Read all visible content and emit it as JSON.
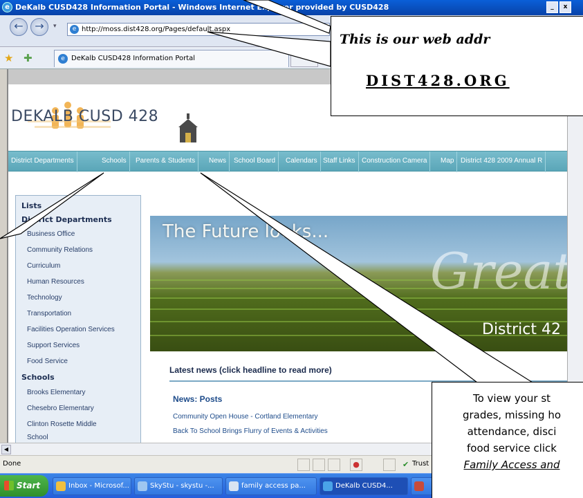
{
  "window": {
    "title": "DeKalb CUSD428 Information Portal - Windows Internet Explorer provided by CUSD428"
  },
  "browser": {
    "address": "http://moss.dist428.org/Pages/default.aspx",
    "tab_title": "DeKalb CUSD428 Information Portal"
  },
  "site": {
    "logo_text": "DEKALB CUSD 428",
    "nav": [
      "District Departments",
      "Schools",
      "Parents & Students",
      "News",
      "School Board",
      "Calendars",
      "Staff Links",
      "Construction Camera",
      "Map",
      "District 428 2009 Annual R"
    ],
    "sidebar": {
      "title": "Lists",
      "section1": "District Departments",
      "depts": [
        "Business Office",
        "Community Relations",
        "Curriculum",
        "Human Resources",
        "Technology",
        "Transportation",
        "Facilities Operation Services",
        "Support Services",
        "Food Service"
      ],
      "section2": "Schools",
      "schools": [
        "Brooks Elementary",
        "Chesebro Elementary",
        "Clinton Rosette Middle",
        "School"
      ]
    },
    "banner": {
      "headline": "The Future looks...",
      "script": "Great!",
      "sub": "District 42"
    },
    "news": {
      "heading": "Latest news (click headline to read more)",
      "posts_heading": "News: Posts",
      "posts": [
        "Community Open House - Cortland Elementary",
        "Back To School Brings Flurry of Events & Activities"
      ]
    }
  },
  "status": {
    "text": "Done",
    "zone": "Trust"
  },
  "taskbar": {
    "start": "Start",
    "items": [
      "Inbox - Microsof...",
      "SkyStu - skystu -...",
      "family access pa...",
      "DeKalb CUSD4...",
      ""
    ]
  },
  "callouts": {
    "address": {
      "line1": "This is our web addr",
      "line2": "DIST428.ORG"
    },
    "info": {
      "lines": [
        "To view your st",
        "grades, missing ho",
        "attendance, disci",
        "food service click",
        "Family Access and"
      ]
    }
  },
  "colors": {
    "nav_bar": "#5aa6b8",
    "sidebar_bg": "#e7eef6",
    "title_bar": "#0842a8",
    "taskbar": "#245edc"
  }
}
